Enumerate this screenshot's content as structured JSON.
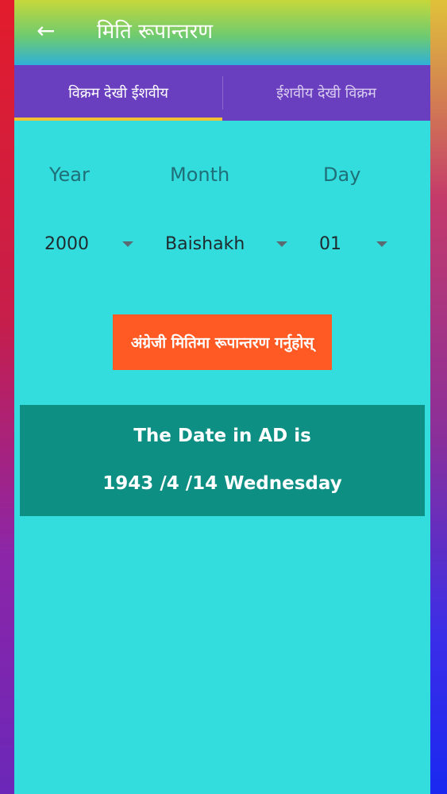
{
  "appbar": {
    "title": "मिति रूपान्तरण",
    "back_icon": "←"
  },
  "tabs": [
    {
      "label": "विक्रम देखी ईशवीय",
      "active": true
    },
    {
      "label": "ईशवीय देखी विक्रम",
      "active": false
    }
  ],
  "form": {
    "labels": {
      "year": "Year",
      "month": "Month",
      "day": "Day"
    },
    "values": {
      "year": "2000",
      "month": "Baishakh",
      "day": "01"
    }
  },
  "convert_button": {
    "label": "अंग्रेजी मितिमा रूपान्तरण गर्नुहोस्"
  },
  "result": {
    "heading": "The Date in AD is",
    "date": "1943 /4 /14 Wednesday"
  },
  "colors": {
    "appbar_top": "#c6d83a",
    "appbar_bottom": "#2fb0d8",
    "tabs_bg": "#6a3fbf",
    "tab_indicator": "#f2c232",
    "content_bg": "#34dddd",
    "button_bg": "#ff5a24",
    "result_bg": "#0e8f84"
  },
  "icons": {
    "back": "arrow-back-icon",
    "dropdown": "caret-down-icon"
  }
}
